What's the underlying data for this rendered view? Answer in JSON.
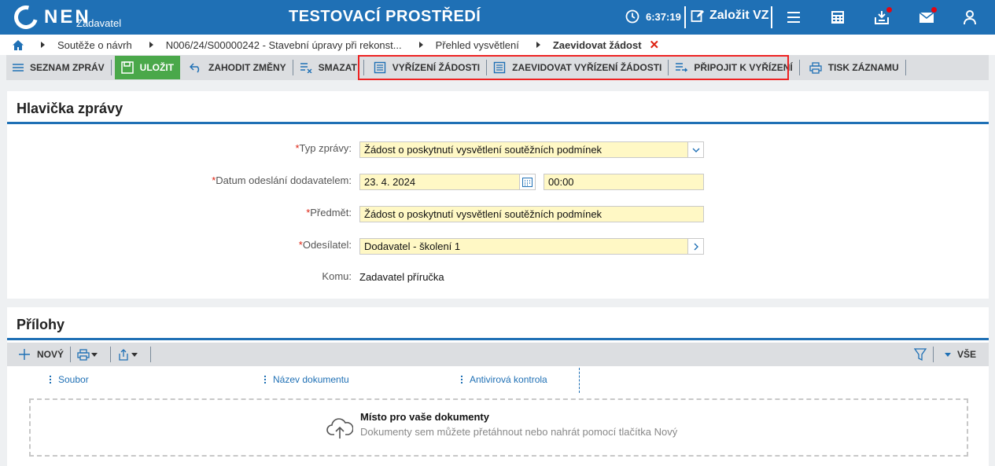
{
  "topbar": {
    "logo_text": "NEN",
    "logo_sub": "Zadavatel",
    "env_title": "TESTOVACÍ PROSTŘEDÍ",
    "time": "6:37:19",
    "create_vz": "Založit VZ"
  },
  "breadcrumb": {
    "items": [
      "Soutěže o návrh",
      "N006/24/S00000242 - Stavební úpravy při rekonst...",
      "Přehled vysvětlení"
    ],
    "active": "Zaevidovat žádost"
  },
  "toolbar": {
    "list": "SEZNAM ZPRÁV",
    "save": "ULOŽIT",
    "discard": "ZAHODIT ZMĚNY",
    "delete": "SMAZAT",
    "resolve": "VYŘÍZENÍ ŽÁDOSTI",
    "register_resolution": "ZAEVIDOVAT VYŘÍZENÍ ŽÁDOSTI",
    "attach": "PŘIPOJIT K VYŘÍZENÍ",
    "print": "TISK ZÁZNAMU"
  },
  "header_panel": {
    "title": "Hlavička zprávy",
    "type_label": "Typ zprávy:",
    "type_value": "Žádost o poskytnutí vysvětlení soutěžních podmínek",
    "date_label": "Datum odeslání dodavatelem:",
    "date_value": "23. 4. 2024",
    "time_value": "00:00",
    "subject_label": "Předmět:",
    "subject_value": "Žádost o poskytnutí vysvětlení soutěžních podmínek",
    "sender_label": "Odesílatel:",
    "sender_value": "Dodavatel - školení 1",
    "to_label": "Komu:",
    "to_value": "Zadavatel příručka"
  },
  "attachments": {
    "title": "Přílohy",
    "new_label": "NOVÝ",
    "all_label": "VŠE",
    "columns": [
      "Soubor",
      "Název dokumentu",
      "Antivirová kontrola"
    ],
    "drop_title": "Místo pro vaše dokumenty",
    "drop_hint": "Dokumenty sem můžete přetáhnout nebo nahrát pomocí tlačítka Nový"
  }
}
